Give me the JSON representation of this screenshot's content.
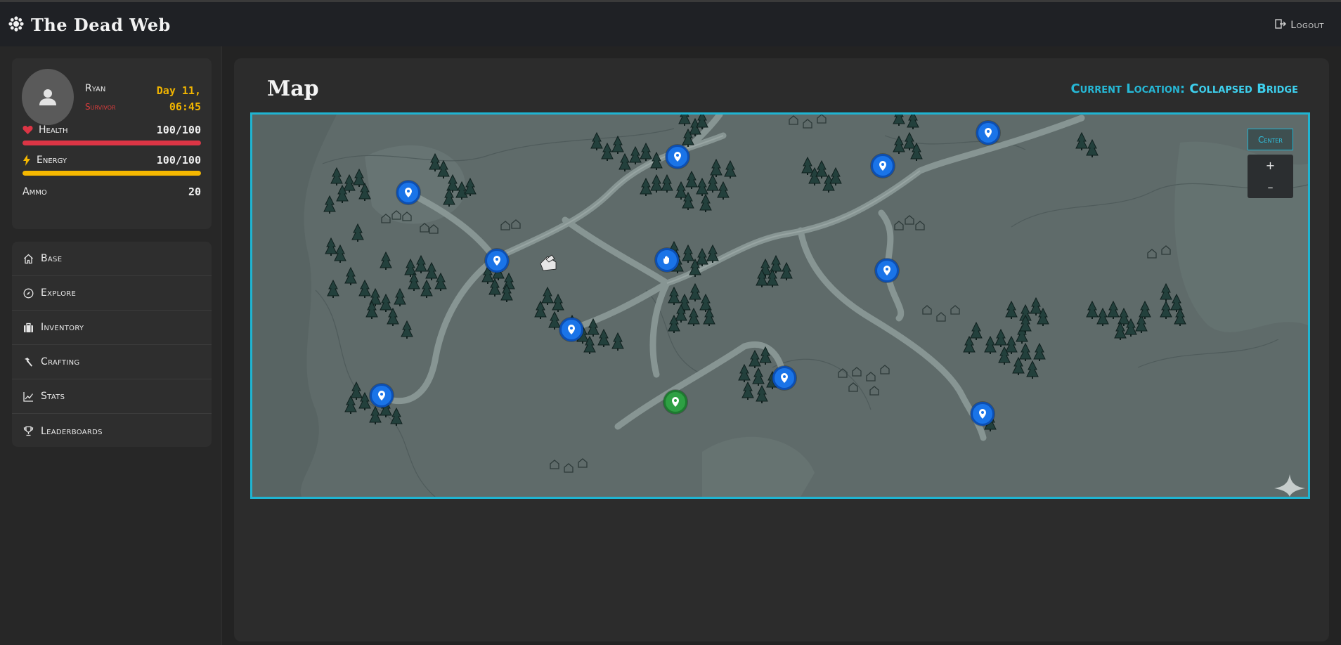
{
  "app": {
    "title": "The Dead Web",
    "logout_label": "Logout"
  },
  "profile": {
    "name": "Ryan",
    "role": "Survivor",
    "day": "Day 11,",
    "time": "06:45"
  },
  "stats": {
    "health": {
      "label": "Health",
      "value": "100/100",
      "level": 1.0,
      "color": "#dc3545"
    },
    "energy": {
      "label": "Energy",
      "value": "100/100",
      "level": 1.0,
      "color": "#f5b800"
    },
    "ammo": {
      "label": "Ammo",
      "value": "20"
    }
  },
  "nav": {
    "items": [
      {
        "label": "Base",
        "icon": "home-icon"
      },
      {
        "label": "Explore",
        "icon": "compass-icon"
      },
      {
        "label": "Inventory",
        "icon": "briefcase-icon"
      },
      {
        "label": "Crafting",
        "icon": "hammer-icon"
      },
      {
        "label": "Stats",
        "icon": "chart-line-icon"
      },
      {
        "label": "Leaderboards",
        "icon": "trophy-icon"
      }
    ]
  },
  "main": {
    "title": "Map",
    "location_label": "Current Location:",
    "location_value": "Collapsed Bridge"
  },
  "map": {
    "center_label": "Center",
    "zoom_in_label": "+",
    "zoom_out_label": "–"
  },
  "colors": {
    "accent": "#1fb4d2",
    "marker": "#1a74e8",
    "current_marker": "#2ea043",
    "health": "#dc3545",
    "energy": "#f5b800"
  }
}
